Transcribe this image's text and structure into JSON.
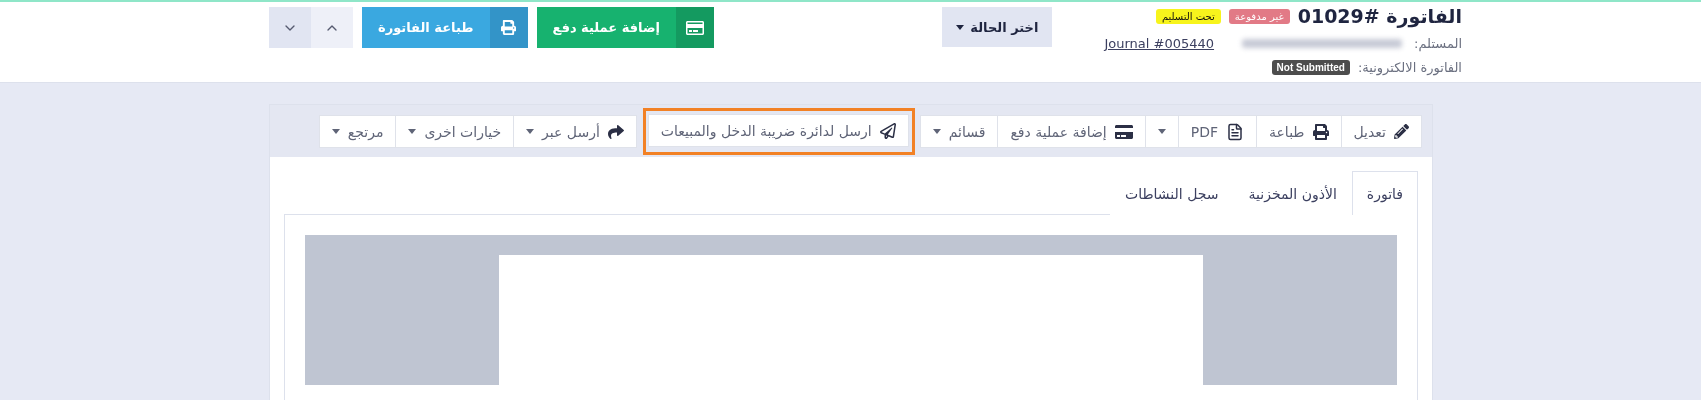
{
  "header": {
    "title": "الفاتورة #01029",
    "badges": [
      {
        "text": "غير مدفوعة",
        "color": "#e27a86"
      },
      {
        "text": "تحت التسليم",
        "color": "#f7f41c"
      }
    ],
    "recipient_label": "المستلم:",
    "journal_link": "Journal #005440",
    "einvoice_label": "الفاتورة الالكترونية:",
    "einvoice_status": "Not Submitted",
    "status_dropdown": "اختر الحالة",
    "actions": [
      {
        "kind": "payment",
        "label": "إضافة عملية دفع"
      },
      {
        "kind": "print",
        "label": "طباعة الفاتورة"
      }
    ]
  },
  "toolbar": [
    {
      "kind": "edit",
      "label": "تعديل",
      "dropdown": false,
      "highlighted": false
    },
    {
      "kind": "print",
      "label": "طباعة",
      "dropdown": false,
      "highlighted": false
    },
    {
      "kind": "pdf",
      "label": "PDF",
      "dropdown": false,
      "highlighted": false
    },
    {
      "kind": "none",
      "dropdown": true,
      "highlighted": false
    },
    {
      "kind": "payment",
      "label": "إضافة عملية دفع",
      "dropdown": false,
      "highlighted": false
    },
    {
      "kind": "none",
      "label": "قسائم",
      "dropdown": true,
      "highlighted": false
    },
    {
      "kind": "send",
      "label": "ارسل لدائرة ضريبة الدخل والمبيعات",
      "dropdown": false,
      "highlighted": true
    },
    {
      "kind": "share",
      "label": "أرسل عبر",
      "dropdown": true,
      "highlighted": false
    },
    {
      "kind": "none",
      "label": "خيارات اخرى",
      "dropdown": true,
      "highlighted": false
    },
    {
      "kind": "none",
      "label": "مرتجع",
      "dropdown": true,
      "highlighted": false
    }
  ],
  "tabs": [
    {
      "label": "فاتورة",
      "selected": true
    },
    {
      "label": "الأذون المخزنية",
      "selected": false
    },
    {
      "label": "سجل النشاطات",
      "selected": false
    }
  ]
}
